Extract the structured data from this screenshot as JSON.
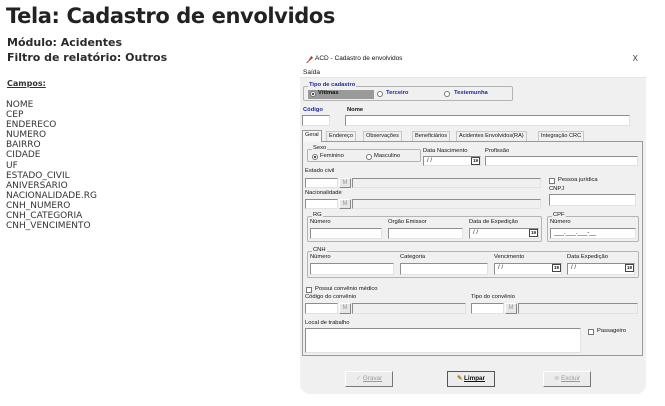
{
  "doc": {
    "title": "Tela: Cadastro de envolvidos",
    "module": "Módulo: Acidentes",
    "report_filter": "Filtro de relatório: Outros",
    "fields_heading": "Campos:",
    "fields": [
      "NOME",
      "CEP",
      "ENDERECO",
      "NUMERO",
      "BAIRRO",
      "CIDADE",
      "UF",
      "ESTADO_CIVIL",
      "ANIVERSARIO",
      "NACIONALIDADE.RG",
      "CNH_NUMERO",
      "CNH_CATEGORIA",
      "CNH_VENCIMENTO"
    ]
  },
  "window": {
    "title": "ACD - Cadastro de envolvidos",
    "close": "X",
    "menu": [
      "Saída"
    ],
    "tipo_cadastro": {
      "legend": "Tipo de cadastro",
      "options": [
        "Vítimas",
        "Terceiro",
        "Testemunha"
      ],
      "selected": "Vítimas"
    },
    "codigo_label": "Código",
    "nome_label": "Nome",
    "tabs": [
      "Geral",
      "Endereço",
      "Observações",
      "Beneficiários",
      "Acidentes Envolvidos(RA)",
      "Integração CRC"
    ],
    "active_tab": "Geral",
    "geral": {
      "sexo": {
        "legend": "Sexo",
        "options": [
          "Feminino",
          "Masculino"
        ],
        "selected": "Feminino"
      },
      "data_nascimento": {
        "label": "Data Nascimento",
        "value": "/ /"
      },
      "profissao_label": "Profissão",
      "estado_civil_label": "Estado civil",
      "pessoa_juridica_label": "Pessoa jurídica",
      "cnpj_label": "CNPJ",
      "nacionalidade_label": "Nacionalidade",
      "rg": {
        "legend": "RG",
        "numero": "Número",
        "orgao": "Orgão Emissor",
        "data_exp": "Data de Expedição",
        "data_value": "/ /"
      },
      "cpf": {
        "legend": "CPF",
        "numero": "Número",
        "mask": "___.___.___-__"
      },
      "cnh": {
        "legend": "CNH",
        "numero": "Número",
        "categoria": "Categoria",
        "vencimento": "Vencimento",
        "vencimento_value": "/ /",
        "data_exp": "Data Expedição",
        "data_exp_value": "/ /"
      },
      "convenio_check": "Possui convênio médico",
      "codigo_convenio": "Código do convênio",
      "tipo_convenio": "Tipo do convênio",
      "local_trabalho": "Local de trabalho",
      "passageiro": "Passageiro"
    },
    "calendar_glyph": "19",
    "lookup_glyph": "M",
    "buttons": {
      "gravar": "Gravar",
      "limpar": "Limpar",
      "excluir": "Excluir"
    }
  }
}
